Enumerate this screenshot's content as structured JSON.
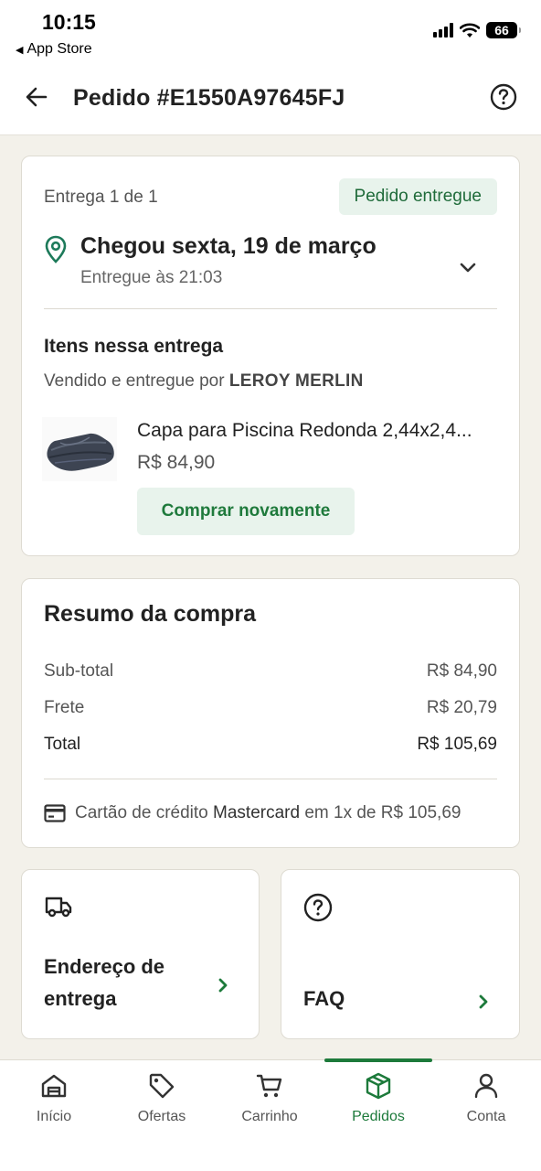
{
  "status_bar": {
    "time": "10:15",
    "back_app": "App Store",
    "battery": "66"
  },
  "header": {
    "title": "Pedido #E1550A97645FJ",
    "back_icon": "arrow-left-icon",
    "help_icon": "question-circle-icon"
  },
  "delivery": {
    "count_label": "Entrega 1 de 1",
    "status": "Pedido entregue",
    "arrived": "Chegou sexta, 19 de março",
    "delivered_time": "Entregue às 21:03",
    "items_title": "Itens nessa entrega",
    "seller_prefix": "Vendido e entregue por ",
    "seller_name": "LEROY MERLIN",
    "product": {
      "name": "Capa para Piscina Redonda 2,44x2,4...",
      "price": "R$ 84,90",
      "buy_again": "Comprar novamente"
    }
  },
  "summary": {
    "title": "Resumo da compra",
    "rows": [
      {
        "label": "Sub-total",
        "value": "R$ 84,90"
      },
      {
        "label": "Frete",
        "value": "R$ 20,79"
      },
      {
        "label": "Total",
        "value": "R$ 105,69"
      }
    ],
    "payment": {
      "prefix": "Cartão de crédito ",
      "brand": "Mastercard",
      "suffix": " em 1x de R$ 105,69"
    }
  },
  "tiles": {
    "address_line1": "Endereço de",
    "address_line2": "entrega",
    "faq": "FAQ"
  },
  "tabs": [
    {
      "label": "Início",
      "icon": "home-icon"
    },
    {
      "label": "Ofertas",
      "icon": "tag-icon"
    },
    {
      "label": "Carrinho",
      "icon": "cart-icon"
    },
    {
      "label": "Pedidos",
      "icon": "box-icon",
      "active": true
    },
    {
      "label": "Conta",
      "icon": "user-icon"
    }
  ],
  "colors": {
    "accent": "#1d7a3b",
    "background": "#f3f1ea",
    "pill_bg": "#e8f3ec"
  }
}
